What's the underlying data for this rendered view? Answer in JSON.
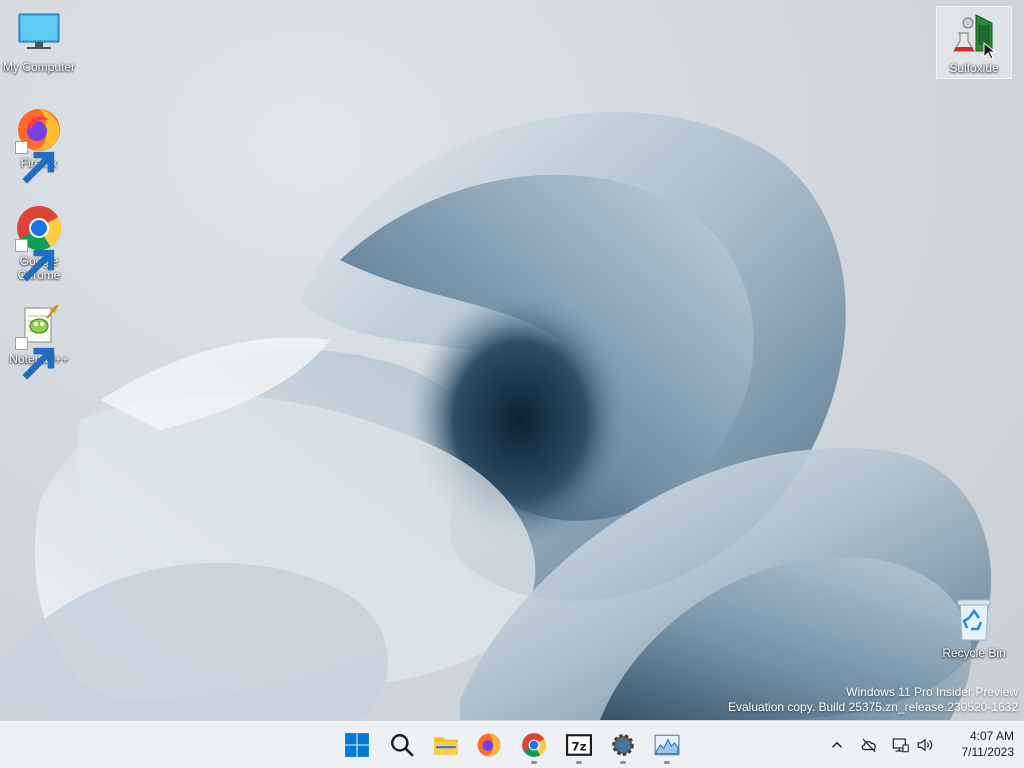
{
  "desktop": {
    "icons": [
      {
        "label": "My Computer",
        "icon": "monitor-icon"
      },
      {
        "label": "Firefox",
        "icon": "firefox-icon"
      },
      {
        "label": "Google Chrome",
        "icon": "chrome-icon"
      },
      {
        "label": "Notepad++",
        "icon": "notepadpp-icon"
      },
      {
        "label": "Sulfoxide",
        "icon": "sulfoxide-icon"
      },
      {
        "label": "Recycle Bin",
        "icon": "recycle-bin-icon"
      }
    ]
  },
  "watermark": {
    "line1": "Windows 11 Pro Insider Preview",
    "line2": "Evaluation copy. Build 25375.zn_release.230520-1632"
  },
  "taskbar": {
    "buttons": [
      {
        "name": "start",
        "icon": "windows-logo-icon"
      },
      {
        "name": "search",
        "icon": "search-icon"
      },
      {
        "name": "file-explorer",
        "icon": "folder-icon"
      },
      {
        "name": "firefox",
        "icon": "firefox-icon"
      },
      {
        "name": "chrome",
        "icon": "chrome-icon"
      },
      {
        "name": "7zip",
        "icon": "7zip-icon",
        "text": "7z"
      },
      {
        "name": "settings",
        "icon": "gear-icon"
      },
      {
        "name": "task-manager",
        "icon": "chart-icon"
      }
    ],
    "tray": {
      "icons": [
        "chevron-up-icon",
        "onedrive-offline-icon",
        "network-icon",
        "volume-icon"
      ],
      "time": "4:07 AM",
      "date": "7/11/2023"
    }
  },
  "colors": {
    "taskbar_bg": "#eef1f4",
    "windows_blue": "#0078d4",
    "desktop_bg": "#d3d9de"
  }
}
